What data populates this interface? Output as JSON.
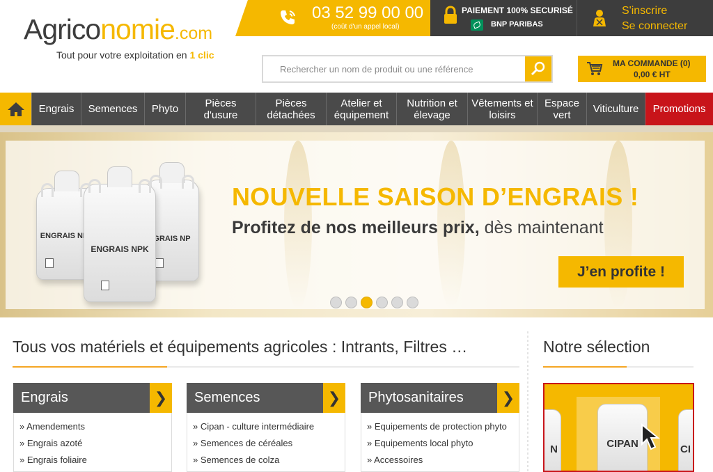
{
  "brand": {
    "logo_part1": "Agrico",
    "logo_part2": "nomie",
    "logo_suffix": ".com",
    "tagline": "Tout pour votre exploitation en",
    "tagline_highlight": "1 clic",
    "primary_color": "#f5b800",
    "dark_color": "#3d3d3d"
  },
  "topbar": {
    "phone_icon": "phone-icon",
    "phone": "03 52 99 00 00",
    "phone_note": "(coût d'un appel local)",
    "payment_icon": "lock-icon",
    "payment_title": "PAIEMENT 100% SECURISÉ",
    "payment_bank": "BNP PARIBAS",
    "account_icon": "user-icon",
    "signup": "S'inscrire",
    "login": "Se connecter"
  },
  "search": {
    "placeholder": "Rechercher un nom de produit ou une référence",
    "icon": "search-icon"
  },
  "cart": {
    "icon": "cart-icon",
    "title": "MA COMMANDE (0)",
    "total": "0,00 € HT"
  },
  "nav": {
    "home_icon": "home-icon",
    "items": [
      {
        "line1": "Engrais",
        "line2": ""
      },
      {
        "line1": "Semences",
        "line2": ""
      },
      {
        "line1": "Phyto",
        "line2": ""
      },
      {
        "line1": "Pièces",
        "line2": "d'usure"
      },
      {
        "line1": "Pièces",
        "line2": "détachées"
      },
      {
        "line1": "Atelier et",
        "line2": "équipement"
      },
      {
        "line1": "Nutrition et",
        "line2": "élevage"
      },
      {
        "line1": "Vêtements et",
        "line2": "loisirs"
      },
      {
        "line1": "Espace",
        "line2": "vert"
      },
      {
        "line1": "Viticulture",
        "line2": ""
      },
      {
        "line1": "Promotions",
        "line2": ""
      }
    ],
    "promo_color": "#c8141a"
  },
  "hero": {
    "bag_labels": [
      "ENGRAIS NPK",
      "ENGRAIS NPK",
      "GRAIS NP"
    ],
    "title": "NOUVELLE SAISON D’ENGRAIS !",
    "subtitle_bold": "Profitez de nos meilleurs prix,",
    "subtitle_rest": " dès maintenant",
    "cta": "J’en profite !",
    "slide_count": 6,
    "active_slide": 3
  },
  "main": {
    "title": "Tous vos matériels et équipements agricoles : Intrants, Filtres …",
    "categories": [
      {
        "title": "Engrais",
        "arrow": "❯",
        "items": [
          "Amendements",
          "Engrais azoté",
          "Engrais foliaire"
        ]
      },
      {
        "title": "Semences",
        "arrow": "❯",
        "items": [
          "Cipan - culture intermédiaire",
          "Semences de céréales",
          "Semences de colza"
        ]
      },
      {
        "title": "Phytosanitaires",
        "arrow": "❯",
        "items": [
          "Equipements de protection phyto",
          "Equipements local phyto",
          "Accessoires"
        ]
      }
    ]
  },
  "selection": {
    "title": "Notre sélection",
    "product_label": "CIPAN",
    "side_label_left": "N",
    "side_label_right": "CI",
    "cursor_icon": "cursor-arrow-icon",
    "border_color": "#c8141a"
  }
}
